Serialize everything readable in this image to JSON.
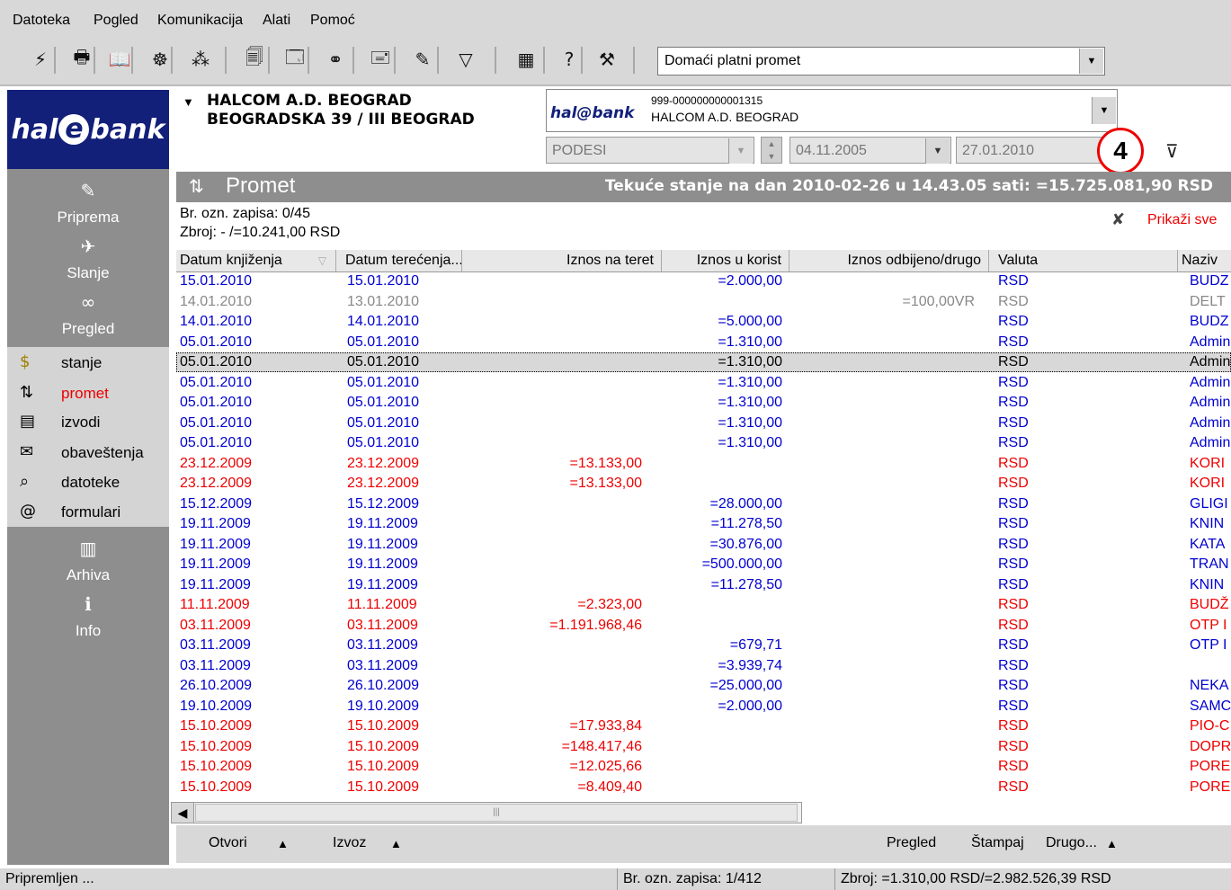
{
  "menu": [
    "Datoteka",
    "Pogled",
    "Komunikacija",
    "Alati",
    "Pomoć"
  ],
  "toolbar": {
    "icons": [
      "lightning-icon",
      "printer-icon",
      "book-icon",
      "globe-icon",
      "numbers-icon",
      "documents-icon",
      "form-icon",
      "binoculars-icon",
      "inbox-icon",
      "edit-icon",
      "filter-icon",
      "calculator-icon",
      "help-icon",
      "tools-icon"
    ],
    "glyphs": [
      "⚡",
      "🖶",
      "📖",
      "☸",
      "⁂",
      "🗐",
      "🗔",
      "⚭",
      "🖃",
      "✎",
      "▽",
      "▦",
      "?",
      "⚒"
    ],
    "mode_value": "Domaći platni promet"
  },
  "sidebar": {
    "logo": {
      "pre": "hal",
      "mid": "e",
      "post": "bank"
    },
    "nav": [
      {
        "label": "Priprema",
        "glyph": "✎",
        "icon": "pencil-icon"
      },
      {
        "label": "Slanje",
        "glyph": "✈",
        "icon": "send-icon"
      },
      {
        "label": "Pregled",
        "glyph": "∞",
        "icon": "binoculars-icon"
      }
    ],
    "sub": [
      {
        "label": "stanje",
        "glyph": "$",
        "icon": "coins-icon",
        "active": false
      },
      {
        "label": "promet",
        "glyph": "⇅",
        "icon": "transactions-icon",
        "active": true
      },
      {
        "label": "izvodi",
        "glyph": "▤",
        "icon": "statement-icon",
        "active": false
      },
      {
        "label": "obaveštenja",
        "glyph": "✉",
        "icon": "mail-icon",
        "active": false
      },
      {
        "label": "datoteke",
        "glyph": "⌕",
        "icon": "search-icon",
        "active": false
      },
      {
        "label": "formulari",
        "glyph": "@",
        "icon": "forms-icon",
        "active": false
      }
    ],
    "bottom": [
      {
        "label": "Arhiva",
        "glyph": "▥",
        "icon": "archive-icon"
      },
      {
        "label": "Info",
        "glyph": "ℹ",
        "icon": "info-icon"
      }
    ]
  },
  "account": {
    "name_line1": "HALCOM A.D. BEOGRAD",
    "name_line2": "BEOGRADSKA 39 / III BEOGRAD",
    "number": "999-000000000001315",
    "holder": "HALCOM A.D. BEOGRAD",
    "logo_text": "hal@bank",
    "preset": "PODESI",
    "date_from": "04.11.2005",
    "date_to": "27.01.2010",
    "callout": "4"
  },
  "section": {
    "title": "Promet",
    "balance": "Tekuće stanje na dan 2010-02-26 u 14.43.05 sati: =15.725.081,90 RSD",
    "marked": "Br. ozn. zapisa: 0/45",
    "sum": "Zbroj: - /=10.241,00 RSD",
    "show_all": "Prikaži sve"
  },
  "table": {
    "columns": [
      "Datum knjiženja",
      "Datum terećenja...",
      "Iznos na teret",
      "Iznos u korist",
      "Iznos odbijeno/drugo",
      "Valuta",
      "Naziv"
    ],
    "rows": [
      {
        "c": "blue",
        "d1": "15.01.2010",
        "d2": "15.01.2010",
        "teret": "",
        "korist": "=2.000,00",
        "drugo": "",
        "val": "RSD",
        "naziv": "BUDZ"
      },
      {
        "c": "gray",
        "d1": "14.01.2010",
        "d2": "13.01.2010",
        "teret": "",
        "korist": "",
        "drugo": "=100,00VR",
        "val": "RSD",
        "naziv": "DELT"
      },
      {
        "c": "blue",
        "d1": "14.01.2010",
        "d2": "14.01.2010",
        "teret": "",
        "korist": "=5.000,00",
        "drugo": "",
        "val": "RSD",
        "naziv": "BUDZ"
      },
      {
        "c": "blue",
        "d1": "05.01.2010",
        "d2": "05.01.2010",
        "teret": "",
        "korist": "=1.310,00",
        "drugo": "",
        "val": "RSD",
        "naziv": "Admin"
      },
      {
        "c": "sel",
        "d1": "05.01.2010",
        "d2": "05.01.2010",
        "teret": "",
        "korist": "=1.310,00",
        "drugo": "",
        "val": "RSD",
        "naziv": "Admin"
      },
      {
        "c": "blue",
        "d1": "05.01.2010",
        "d2": "05.01.2010",
        "teret": "",
        "korist": "=1.310,00",
        "drugo": "",
        "val": "RSD",
        "naziv": "Admin"
      },
      {
        "c": "blue",
        "d1": "05.01.2010",
        "d2": "05.01.2010",
        "teret": "",
        "korist": "=1.310,00",
        "drugo": "",
        "val": "RSD",
        "naziv": "Admin"
      },
      {
        "c": "blue",
        "d1": "05.01.2010",
        "d2": "05.01.2010",
        "teret": "",
        "korist": "=1.310,00",
        "drugo": "",
        "val": "RSD",
        "naziv": "Admin"
      },
      {
        "c": "blue",
        "d1": "05.01.2010",
        "d2": "05.01.2010",
        "teret": "",
        "korist": "=1.310,00",
        "drugo": "",
        "val": "RSD",
        "naziv": "Admin"
      },
      {
        "c": "red",
        "d1": "23.12.2009",
        "d2": "23.12.2009",
        "teret": "=13.133,00",
        "korist": "",
        "drugo": "",
        "val": "RSD",
        "naziv": "KORI"
      },
      {
        "c": "red",
        "d1": "23.12.2009",
        "d2": "23.12.2009",
        "teret": "=13.133,00",
        "korist": "",
        "drugo": "",
        "val": "RSD",
        "naziv": "KORI"
      },
      {
        "c": "blue",
        "d1": "15.12.2009",
        "d2": "15.12.2009",
        "teret": "",
        "korist": "=28.000,00",
        "drugo": "",
        "val": "RSD",
        "naziv": "GLIGI"
      },
      {
        "c": "blue",
        "d1": "19.11.2009",
        "d2": "19.11.2009",
        "teret": "",
        "korist": "=11.278,50",
        "drugo": "",
        "val": "RSD",
        "naziv": "KNIN"
      },
      {
        "c": "blue",
        "d1": "19.11.2009",
        "d2": "19.11.2009",
        "teret": "",
        "korist": "=30.876,00",
        "drugo": "",
        "val": "RSD",
        "naziv": "KATA"
      },
      {
        "c": "blue",
        "d1": "19.11.2009",
        "d2": "19.11.2009",
        "teret": "",
        "korist": "=500.000,00",
        "drugo": "",
        "val": "RSD",
        "naziv": "TRAN"
      },
      {
        "c": "blue",
        "d1": "19.11.2009",
        "d2": "19.11.2009",
        "teret": "",
        "korist": "=11.278,50",
        "drugo": "",
        "val": "RSD",
        "naziv": "KNIN"
      },
      {
        "c": "red",
        "d1": "11.11.2009",
        "d2": "11.11.2009",
        "teret": "=2.323,00",
        "korist": "",
        "drugo": "",
        "val": "RSD",
        "naziv": "BUDŽ"
      },
      {
        "c": "red",
        "d1": "03.11.2009",
        "d2": "03.11.2009",
        "teret": "=1.191.968,46",
        "korist": "",
        "drugo": "",
        "val": "RSD",
        "naziv": "OTP I"
      },
      {
        "c": "blue",
        "d1": "03.11.2009",
        "d2": "03.11.2009",
        "teret": "",
        "korist": "=679,71",
        "drugo": "",
        "val": "RSD",
        "naziv": "OTP I"
      },
      {
        "c": "blue",
        "d1": "03.11.2009",
        "d2": "03.11.2009",
        "teret": "",
        "korist": "=3.939,74",
        "drugo": "",
        "val": "RSD",
        "naziv": ""
      },
      {
        "c": "blue",
        "d1": "26.10.2009",
        "d2": "26.10.2009",
        "teret": "",
        "korist": "=25.000,00",
        "drugo": "",
        "val": "RSD",
        "naziv": "NEKA"
      },
      {
        "c": "blue",
        "d1": "19.10.2009",
        "d2": "19.10.2009",
        "teret": "",
        "korist": "=2.000,00",
        "drugo": "",
        "val": "RSD",
        "naziv": "SAMC"
      },
      {
        "c": "red",
        "d1": "15.10.2009",
        "d2": "15.10.2009",
        "teret": "=17.933,84",
        "korist": "",
        "drugo": "",
        "val": "RSD",
        "naziv": "PIO-C"
      },
      {
        "c": "red",
        "d1": "15.10.2009",
        "d2": "15.10.2009",
        "teret": "=148.417,46",
        "korist": "",
        "drugo": "",
        "val": "RSD",
        "naziv": "DOPR"
      },
      {
        "c": "red",
        "d1": "15.10.2009",
        "d2": "15.10.2009",
        "teret": "=12.025,66",
        "korist": "",
        "drugo": "",
        "val": "RSD",
        "naziv": "PORE"
      },
      {
        "c": "red",
        "d1": "15.10.2009",
        "d2": "15.10.2009",
        "teret": "=8.409,40",
        "korist": "",
        "drugo": "",
        "val": "RSD",
        "naziv": "PORE"
      }
    ]
  },
  "actions": {
    "open": "Otvori",
    "export": "Izvoz",
    "preview": "Pregled",
    "print": "Štampaj",
    "other": "Drugo..."
  },
  "status": {
    "state": "Pripremljen ...",
    "marked": "Br. ozn. zapisa: 1/412",
    "sum": "Zbroj: =1.310,00 RSD/=2.982.526,39 RSD"
  },
  "colors": {
    "blue": "#0000d0",
    "red": "#ee0000",
    "gray": "#888888",
    "logo_bg": "#13207a"
  }
}
